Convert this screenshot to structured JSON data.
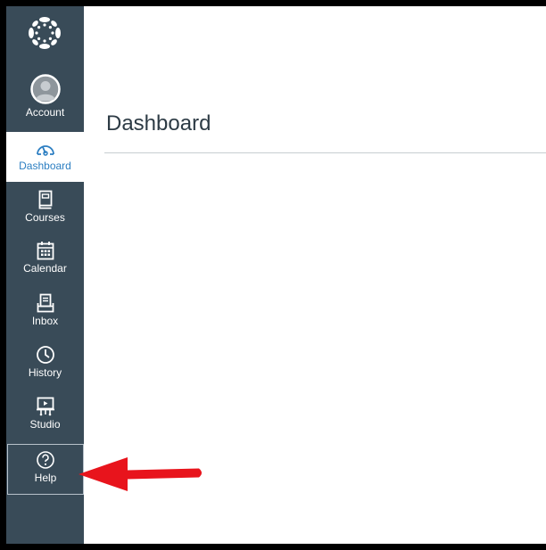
{
  "nav": {
    "account": "Account",
    "dashboard": "Dashboard",
    "courses": "Courses",
    "calendar": "Calendar",
    "inbox": "Inbox",
    "history": "History",
    "studio": "Studio",
    "help": "Help"
  },
  "main": {
    "title": "Dashboard"
  },
  "colors": {
    "sidebar": "#394b58",
    "accent": "#2d7fc2",
    "annotation_arrow": "#e8141c"
  },
  "icons": {
    "logo": "canvas-logo-icon",
    "account": "avatar-icon",
    "dashboard": "speedometer-icon",
    "courses": "book-icon",
    "calendar": "calendar-icon",
    "inbox": "inbox-icon",
    "history": "clock-icon",
    "studio": "presentation-icon",
    "help": "question-circle-icon"
  }
}
